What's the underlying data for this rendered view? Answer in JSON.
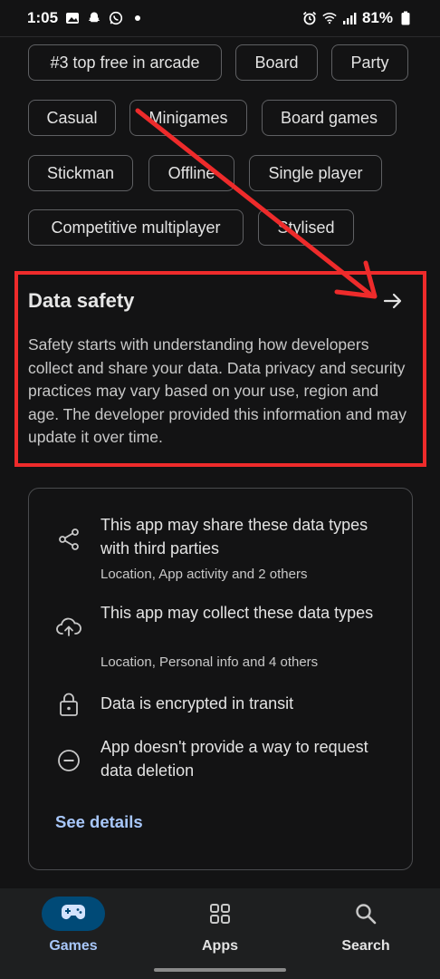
{
  "status_bar": {
    "time": "1:05",
    "battery": "81%",
    "left_icons": [
      "gallery-icon",
      "snapchat-icon",
      "whatsapp-icon",
      "dot-icon"
    ],
    "right_icons": [
      "alarm-icon",
      "wifi-icon",
      "signal-icon",
      "battery-icon"
    ]
  },
  "tags": [
    "#3 top free in arcade",
    "Board",
    "Party",
    "Casual",
    "Minigames",
    "Board games",
    "Stickman",
    "Offline",
    "Single player",
    "Competitive multiplayer",
    "Stylised"
  ],
  "data_safety": {
    "title": "Data safety",
    "description": "Safety starts with understanding how developers collect and share your data. Data privacy and security practices may vary based on your use, region and age. The developer provided this information and may update it over time.",
    "arrow_icon": "arrow-right-icon",
    "highlight_color": "#ee2b2b"
  },
  "card": {
    "rows": [
      {
        "icon": "share-icon",
        "title": "This app may share these data types with third parties",
        "subtitle": "Location, App activity and 2 others"
      },
      {
        "icon": "cloud-upload-icon",
        "title": "This app may collect these data types",
        "subtitle": "Location, Personal info and 4 others"
      },
      {
        "icon": "lock-icon",
        "title": "Data is encrypted in transit",
        "subtitle": ""
      },
      {
        "icon": "minus-circle-icon",
        "title": "App doesn't provide a way to request data deletion",
        "subtitle": ""
      }
    ],
    "see_details": "See details"
  },
  "bottom_nav": {
    "items": [
      {
        "label": "Games",
        "icon": "gamepad-icon",
        "active": true
      },
      {
        "label": "Apps",
        "icon": "apps-grid-icon",
        "active": false
      },
      {
        "label": "Search",
        "icon": "search-icon",
        "active": false
      }
    ],
    "active_color": "#a8c7fa",
    "active_pill_color": "#004a77"
  }
}
